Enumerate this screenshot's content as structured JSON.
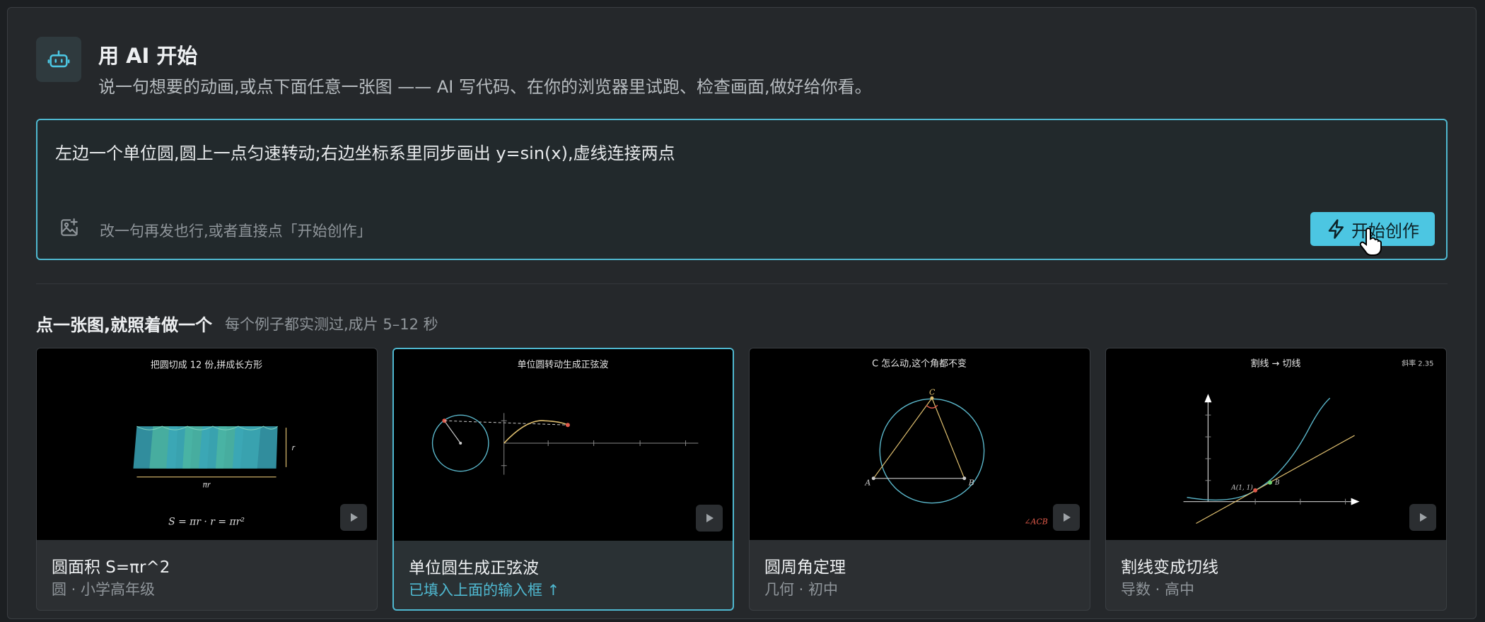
{
  "header": {
    "icon": "robot-icon",
    "title": "用 AI 开始",
    "subtitle": "说一句想要的动画,或点下面任意一张图 —— AI 写代码、在你的浏览器里试跑、检查画面,做好给你看。"
  },
  "prompt": {
    "value": "左边一个单位圆,圆上一点匀速转动;右边坐标系里同步画出 y=sin(x),虚线连接两点",
    "hint": "改一句再发也行,或者直接点「开始创作」",
    "start_label": "开始创作"
  },
  "examples": {
    "title": "点一张图,就照着做一个",
    "note": "每个例子都实测过,成片 5–12 秒",
    "cards": [
      {
        "thumb_title": "把圆切成 12 份,拼成长方形",
        "thumb_formula": "S = πr · r = πr²",
        "thumb_r": "r",
        "thumb_pir": "πr",
        "title": "圆面积 S=πr^2",
        "meta": "圆 · 小学高年级"
      },
      {
        "thumb_title": "单位圆转动生成正弦波",
        "title": "单位圆生成正弦波",
        "meta": "已填入上面的输入框 ↑"
      },
      {
        "thumb_title": "C 怎么动,这个角都不变",
        "thumb_a": "A",
        "thumb_b": "B",
        "thumb_c": "C",
        "thumb_angle": "∠ACB",
        "title": "圆周角定理",
        "meta": "几何 · 初中"
      },
      {
        "thumb_title": "割线 → 切线",
        "thumb_slope": "斜率 2.35",
        "thumb_a": "A(1, 1)",
        "thumb_b": "B",
        "title": "割线变成切线",
        "meta": "导数 · 高中"
      }
    ]
  },
  "colors": {
    "accent": "#4cc6e2",
    "selected_border": "#4fb8d0"
  }
}
